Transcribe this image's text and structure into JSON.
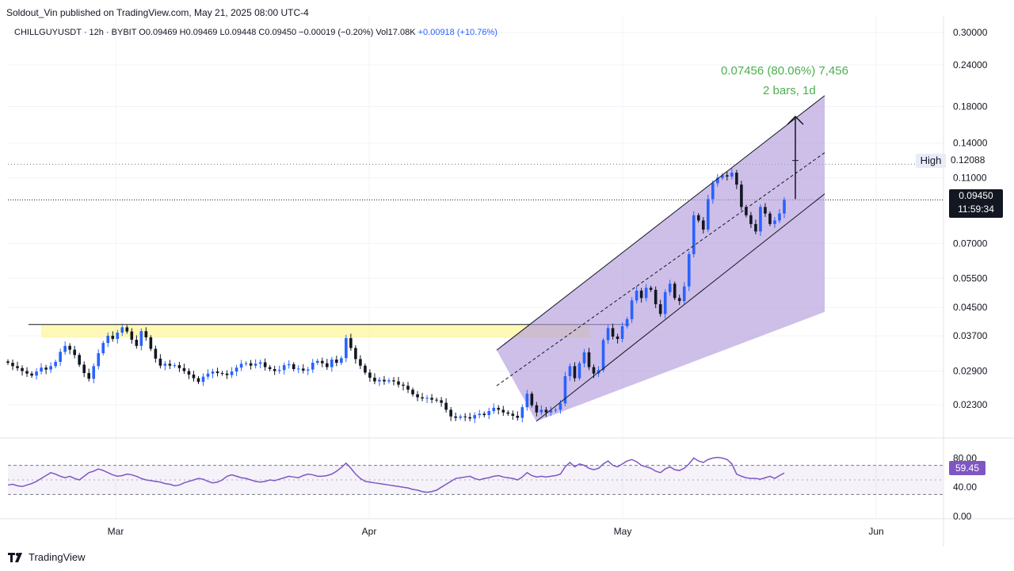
{
  "publisher": "Soldout_Vin published on TradingView.com, May 21, 2025 08:00 UTC-4",
  "legend": {
    "main": "CHILLGUYUSDT · 12h · BYBIT  O0.09469  H0.09469  L0.09448  C0.09450  −0.00019 (−0.20%)  Vol17.08K",
    "change": "+0.00918 (+10.76%)"
  },
  "price_axis": {
    "labels": [
      "0.30000",
      "0.24000",
      "0.18000",
      "0.14000",
      "0.11000",
      "0.07000",
      "0.05500",
      "0.04500",
      "0.03700",
      "0.02900",
      "0.02300"
    ],
    "high_label": "High",
    "high_value": "0.12088",
    "current_price": "0.09450",
    "countdown": "11:59:34"
  },
  "rsi_axis": {
    "labels": [
      "80.00",
      "40.00",
      "0.00"
    ],
    "current": "59.45"
  },
  "time_axis": {
    "labels": [
      "Mar",
      "Apr",
      "May",
      "Jun"
    ]
  },
  "measure": {
    "line1": "0.07456 (80.06%) 7,456",
    "line2": "2 bars, 1d"
  },
  "footer": {
    "brand": "TradingView"
  },
  "colors": {
    "up": "#2962ff",
    "down": "#131722",
    "channel_fill": "#b39ddb",
    "zone_fill": "#fff59d",
    "rsi_line": "#7e57c2",
    "measure_text": "#4caf50"
  },
  "chart_data": {
    "type": "candlestick",
    "symbol": "CHILLGUYUSDT",
    "interval": "12h",
    "exchange": "BYBIT",
    "y_scale": "log",
    "ylim": [
      0.0205,
      0.305
    ],
    "grid": true,
    "last_close": 0.0945,
    "period_high": 0.12088,
    "closes_approx": [
      0.0307,
      0.03,
      0.0296,
      0.029,
      0.0285,
      0.0281,
      0.0289,
      0.0297,
      0.0293,
      0.03,
      0.0309,
      0.0331,
      0.0345,
      0.0336,
      0.0324,
      0.0303,
      0.0286,
      0.0275,
      0.03,
      0.0328,
      0.0352,
      0.037,
      0.0362,
      0.0378,
      0.0392,
      0.0381,
      0.036,
      0.0345,
      0.0382,
      0.0366,
      0.0338,
      0.0316,
      0.0301,
      0.0305,
      0.0301,
      0.0302,
      0.0296,
      0.029,
      0.0283,
      0.0276,
      0.0269,
      0.0279,
      0.0285,
      0.0289,
      0.0286,
      0.0285,
      0.0282,
      0.0289,
      0.0297,
      0.0305,
      0.0306,
      0.0301,
      0.0305,
      0.0308,
      0.0298,
      0.0294,
      0.029,
      0.0292,
      0.0302,
      0.0304,
      0.0294,
      0.0295,
      0.0291,
      0.0293,
      0.0307,
      0.0311,
      0.0306,
      0.0298,
      0.0314,
      0.0307,
      0.0317,
      0.0364,
      0.034,
      0.0315,
      0.0301,
      0.0287,
      0.0277,
      0.027,
      0.0273,
      0.027,
      0.0272,
      0.027,
      0.0264,
      0.0262,
      0.0255,
      0.0247,
      0.0242,
      0.024,
      0.0241,
      0.0238,
      0.0237,
      0.0233,
      0.0222,
      0.0212,
      0.021,
      0.0212,
      0.0211,
      0.0209,
      0.0214,
      0.0216,
      0.0214,
      0.022,
      0.0225,
      0.0222,
      0.0218,
      0.0216,
      0.0213,
      0.021,
      0.0226,
      0.0248,
      0.0229,
      0.0218,
      0.0222,
      0.0218,
      0.0221,
      0.0222,
      0.0232,
      0.028,
      0.03,
      0.0276,
      0.0306,
      0.033,
      0.0298,
      0.0285,
      0.0292,
      0.0359,
      0.039,
      0.0368,
      0.0362,
      0.0395,
      0.0415,
      0.0472,
      0.0505,
      0.048,
      0.0515,
      0.0508,
      0.046,
      0.043,
      0.05,
      0.053,
      0.048,
      0.047,
      0.052,
      0.065,
      0.085,
      0.082,
      0.077,
      0.095,
      0.106,
      0.11,
      0.112,
      0.111,
      0.114,
      0.105,
      0.09,
      0.085,
      0.08,
      0.076,
      0.09,
      0.086,
      0.08,
      0.082,
      0.086,
      0.0945
    ],
    "overlays": {
      "horizontal_zone": [
        0.0365,
        0.04
      ],
      "channel_upper": [
        [
          0.0335,
          0.194
        ]
      ],
      "channel_lower": [
        [
          0.0205,
          0.099
        ]
      ],
      "projection_arrow": [
        0.095,
        0.168
      ]
    },
    "rsi": {
      "ylim": [
        0,
        100
      ],
      "levels": [
        70,
        30
      ],
      "values": [
        43,
        44,
        42,
        41,
        43,
        45,
        48,
        52,
        56,
        60,
        58,
        55,
        53,
        55,
        52,
        50,
        55,
        60,
        62,
        65,
        63,
        60,
        57,
        55,
        56,
        58,
        57,
        55,
        52,
        50,
        49,
        48,
        47,
        45,
        44,
        42,
        43,
        46,
        48,
        50,
        52,
        51,
        48,
        46,
        47,
        50,
        55,
        57,
        55,
        53,
        52,
        50,
        48,
        47,
        48,
        50,
        49,
        51,
        53,
        55,
        54,
        53,
        56,
        58,
        57,
        55,
        55,
        56,
        58,
        62,
        67,
        73,
        66,
        58,
        52,
        48,
        47,
        46,
        45,
        44,
        43,
        42,
        41,
        40,
        39,
        37,
        36,
        34,
        33,
        34,
        36,
        40,
        44,
        48,
        52,
        53,
        54,
        55,
        52,
        50,
        52,
        53,
        55,
        56,
        54,
        53,
        52,
        50,
        54,
        60,
        56,
        54,
        55,
        54,
        55,
        56,
        58,
        68,
        74,
        68,
        72,
        70,
        66,
        64,
        66,
        72,
        76,
        70,
        68,
        72,
        76,
        78,
        75,
        70,
        68,
        66,
        62,
        60,
        65,
        68,
        64,
        63,
        66,
        72,
        80,
        76,
        74,
        78,
        80,
        81,
        80,
        78,
        72,
        58,
        55,
        53,
        52,
        52,
        51,
        53,
        55,
        52,
        56,
        59.45
      ]
    }
  }
}
